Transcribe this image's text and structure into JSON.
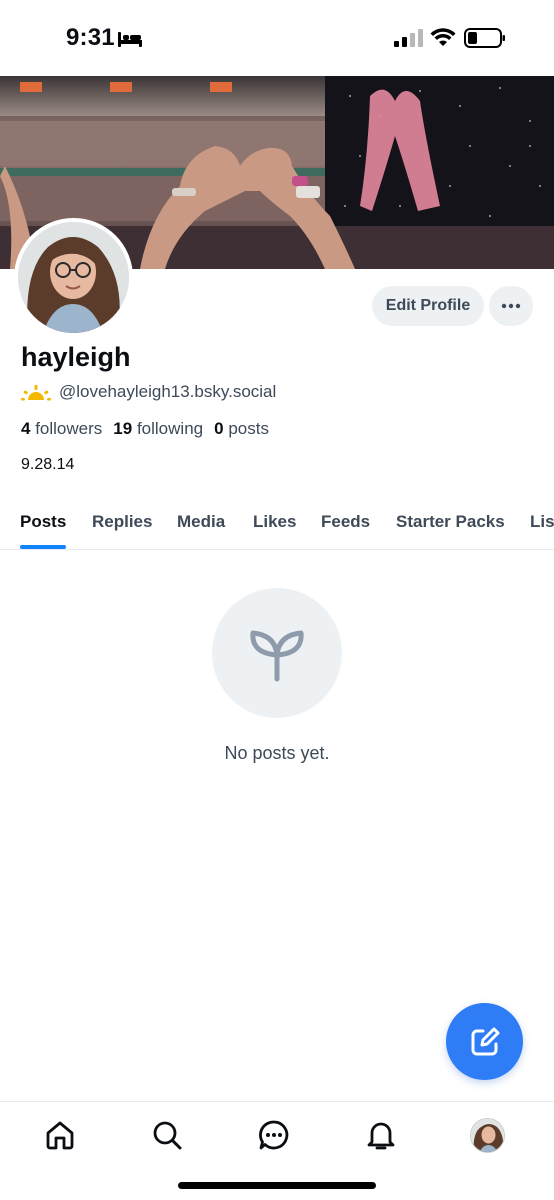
{
  "status_bar": {
    "time": "9:31",
    "icons": [
      "bed-icon",
      "signal-icon",
      "wifi-icon",
      "battery-icon"
    ]
  },
  "profile": {
    "display_name": "hayleigh",
    "handle_icon": "sun-emoji-icon",
    "handle": "@lovehayleigh13.bsky.social",
    "followers_count": "4",
    "followers_label": "followers",
    "following_count": "19",
    "following_label": "following",
    "posts_count": "0",
    "posts_label": "posts",
    "bio": "9.28.14"
  },
  "actions": {
    "edit_profile_label": "Edit Profile",
    "more_icon": "ellipsis-icon"
  },
  "tabs": [
    {
      "label": "Posts",
      "active": true
    },
    {
      "label": "Replies",
      "active": false
    },
    {
      "label": "Media",
      "active": false
    },
    {
      "label": "Likes",
      "active": false
    },
    {
      "label": "Feeds",
      "active": false
    },
    {
      "label": "Starter Packs",
      "active": false
    },
    {
      "label": "Lists",
      "active": false
    }
  ],
  "empty_state": {
    "icon": "sprout-icon",
    "message": "No posts yet."
  },
  "fab": {
    "icon": "compose-icon"
  },
  "bottom_nav": {
    "items": [
      "home-icon",
      "search-icon",
      "chat-icon",
      "bell-icon",
      "profile-avatar"
    ]
  },
  "colors": {
    "accent": "#1083fe",
    "fab": "#2f7df6",
    "muted_text": "#3e4a58",
    "chip_bg": "#eef1f4"
  }
}
